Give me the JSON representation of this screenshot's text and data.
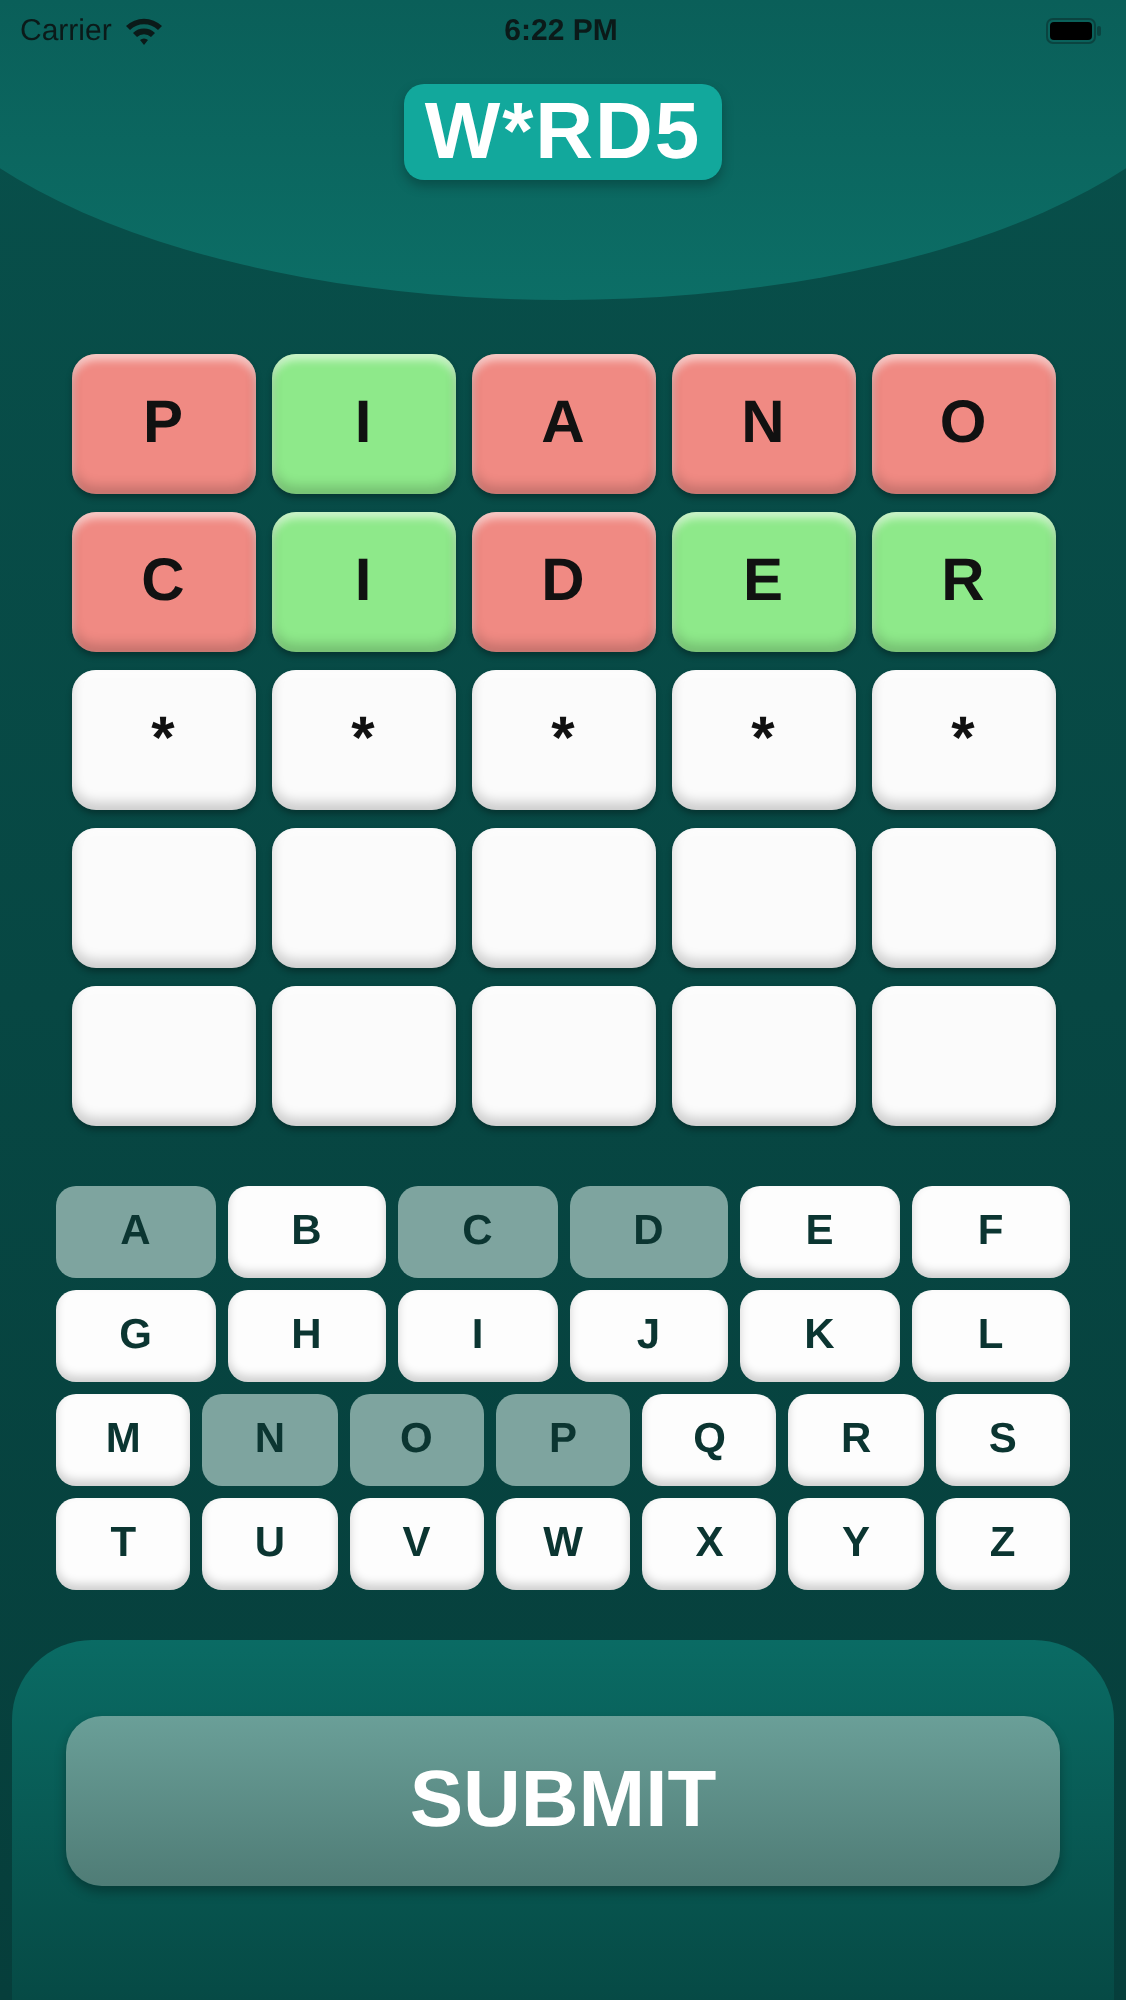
{
  "status_bar": {
    "carrier": "Carrier",
    "time": "6:22 PM"
  },
  "logo": "W*RD5",
  "board": [
    [
      {
        "letter": "P",
        "kind": "absent"
      },
      {
        "letter": "I",
        "kind": "correct"
      },
      {
        "letter": "A",
        "kind": "absent"
      },
      {
        "letter": "N",
        "kind": "absent"
      },
      {
        "letter": "O",
        "kind": "absent"
      }
    ],
    [
      {
        "letter": "C",
        "kind": "absent"
      },
      {
        "letter": "I",
        "kind": "correct"
      },
      {
        "letter": "D",
        "kind": "absent"
      },
      {
        "letter": "E",
        "kind": "correct"
      },
      {
        "letter": "R",
        "kind": "correct"
      }
    ],
    [
      {
        "letter": "*",
        "kind": "empty"
      },
      {
        "letter": "*",
        "kind": "empty"
      },
      {
        "letter": "*",
        "kind": "empty"
      },
      {
        "letter": "*",
        "kind": "empty"
      },
      {
        "letter": "*",
        "kind": "empty"
      }
    ],
    [
      {
        "kind": "empty"
      },
      {
        "kind": "empty"
      },
      {
        "kind": "empty"
      },
      {
        "kind": "empty"
      },
      {
        "kind": "empty"
      }
    ],
    [
      {
        "kind": "empty"
      },
      {
        "kind": "empty"
      },
      {
        "kind": "empty"
      },
      {
        "kind": "empty"
      },
      {
        "kind": "empty"
      }
    ]
  ],
  "keyboard": [
    [
      {
        "label": "A",
        "used": true
      },
      {
        "label": "B",
        "used": false
      },
      {
        "label": "C",
        "used": true
      },
      {
        "label": "D",
        "used": true
      },
      {
        "label": "E",
        "used": false
      },
      {
        "label": "F",
        "used": false
      }
    ],
    [
      {
        "label": "G",
        "used": false
      },
      {
        "label": "H",
        "used": false
      },
      {
        "label": "I",
        "used": false
      },
      {
        "label": "J",
        "used": false
      },
      {
        "label": "K",
        "used": false
      },
      {
        "label": "L",
        "used": false
      }
    ],
    [
      {
        "label": "M",
        "used": false
      },
      {
        "label": "N",
        "used": true
      },
      {
        "label": "O",
        "used": true
      },
      {
        "label": "P",
        "used": true
      },
      {
        "label": "Q",
        "used": false
      },
      {
        "label": "R",
        "used": false
      },
      {
        "label": "S",
        "used": false
      }
    ],
    [
      {
        "label": "T",
        "used": false
      },
      {
        "label": "U",
        "used": false
      },
      {
        "label": "V",
        "used": false
      },
      {
        "label": "W",
        "used": false
      },
      {
        "label": "X",
        "used": false
      },
      {
        "label": "Y",
        "used": false
      },
      {
        "label": "Z",
        "used": false
      }
    ]
  ],
  "submit": {
    "label": "SUBMIT",
    "disabled": true
  }
}
